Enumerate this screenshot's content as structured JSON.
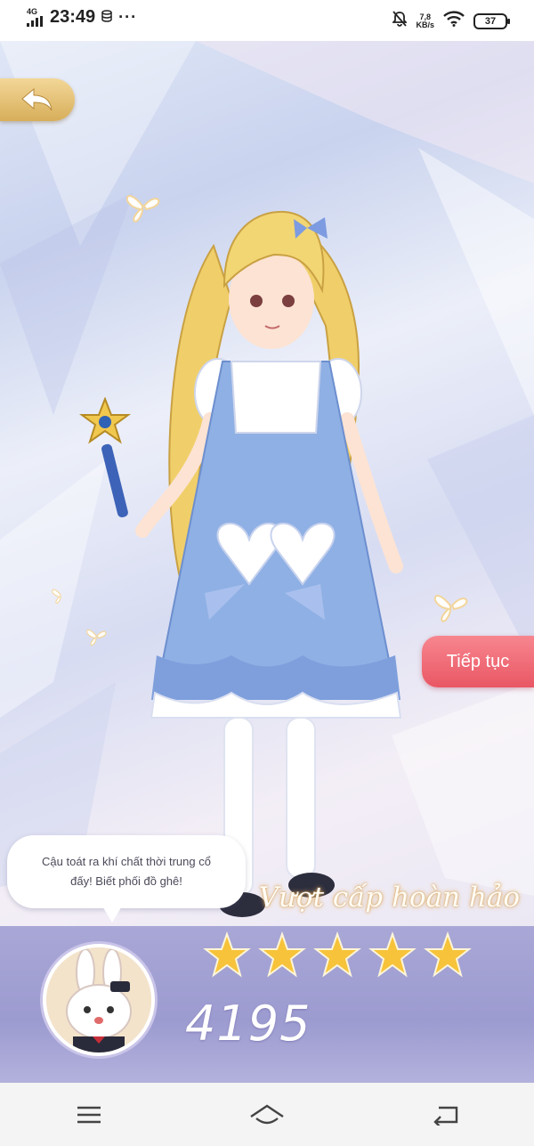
{
  "status_bar": {
    "network": "4G",
    "time": "23:49",
    "speed_value": "7,8",
    "speed_unit": "KB/s",
    "battery": "37"
  },
  "game": {
    "continue_label": "Tiếp tục",
    "speech_line1": "Cậu toát ra khí chất thời trung cổ",
    "speech_line2": "đấy! Biết phối đồ ghê!",
    "rank_title": "Vượt cấp hoàn hảo",
    "stars_earned": 5,
    "stars_total": 5,
    "score": "4195",
    "colors": {
      "back_button": "#e2bd6f",
      "continue_button": "#ef6b76",
      "result_panel": "#a3a1d3",
      "star": "#f7c33a"
    }
  },
  "nav_bar": {
    "icons": [
      "menu-icon",
      "home-icon",
      "back-icon"
    ]
  }
}
